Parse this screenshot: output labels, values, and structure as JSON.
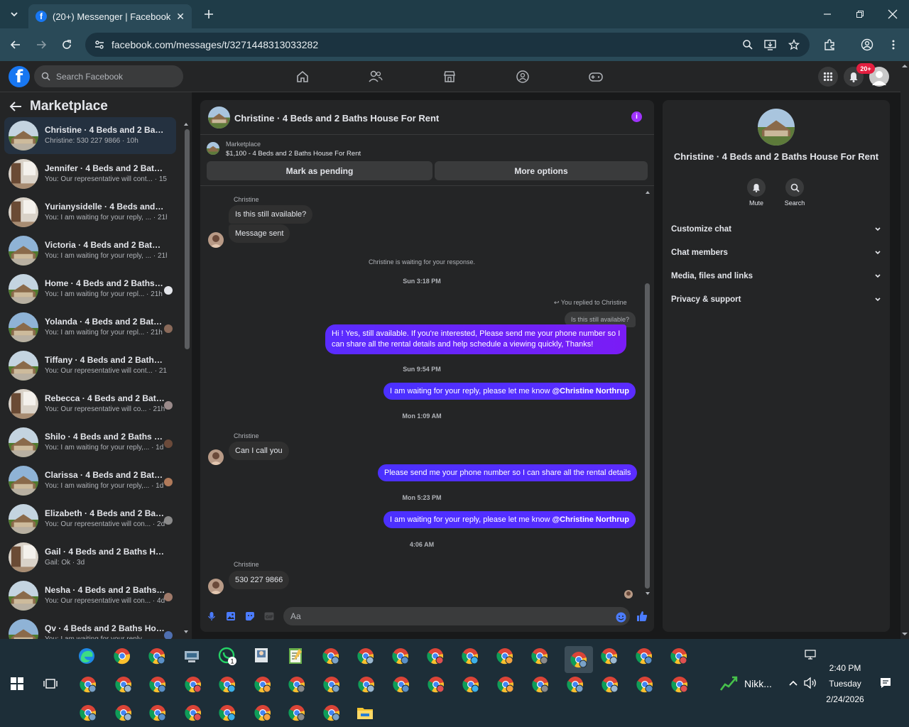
{
  "browser": {
    "tab_title": "(20+) Messenger | Facebook",
    "url": "facebook.com/messages/t/3271448313033282"
  },
  "fb_header": {
    "search_placeholder": "Search Facebook",
    "notification_badge": "20+"
  },
  "left_panel": {
    "title": "Marketplace",
    "conversations": [
      {
        "name": "Christine · 4 Beds and 2 Baths ...",
        "snippet": "Christine: 530 227 9866 · 10h",
        "active": true
      },
      {
        "name": "Jennifer · 4 Beds and 2 Baths H...",
        "snippet": "You: Our representative will cont... · 15h"
      },
      {
        "name": "Yurianysidelle · 4 Beds and 2 Ba...",
        "snippet": "You: I am waiting for your reply, ... · 21h"
      },
      {
        "name": "Victoria · 4 Beds and 2 Baths H...",
        "snippet": "You: I am waiting for your reply, ... · 21h"
      },
      {
        "name": "Home · 4 Beds and 2 Baths H...",
        "snippet": "You: I am waiting for your repl... · 21h"
      },
      {
        "name": "Yolanda · 4 Beds and 2 Baths ...",
        "snippet": "You: I am waiting for your repl... · 21h"
      },
      {
        "name": "Tiffany · 4 Beds and 2 Baths Ho...",
        "snippet": "You: Our representative will cont... · 21h"
      },
      {
        "name": "Rebecca · 4 Beds and 2 Baths...",
        "snippet": "You: Our representative will co... · 21h"
      },
      {
        "name": "Shilo · 4 Beds and 2 Baths Ho...",
        "snippet": "You: I am waiting for your reply,... · 1d"
      },
      {
        "name": "Clarissa · 4 Beds and 2 Baths ...",
        "snippet": "You: I am waiting for your reply,... · 1d"
      },
      {
        "name": "Elizabeth · 4 Beds and 2 Bath...",
        "snippet": "You: Our representative will con... · 2d"
      },
      {
        "name": "Gail · 4 Beds and 2 Baths House...",
        "snippet": "Gail: Ok · 3d"
      },
      {
        "name": "Nesha · 4 Beds and 2 Baths H...",
        "snippet": "You: Our representative will con... · 4d"
      },
      {
        "name": "Qv · 4 Beds and 2 Baths Hous...",
        "snippet": "You: I am waiting for your reply..."
      }
    ]
  },
  "chat": {
    "title": "Christine · 4 Beds and 2 Baths House For Rent",
    "marketplace_label": "Marketplace",
    "listing": "$1,100 - 4 Beds and 2 Baths House For Rent",
    "mark_pending": "Mark as pending",
    "more_options": "More options",
    "sender1": "Christine",
    "msg1": "Is this still available?",
    "msg2": "Message sent",
    "waiting": "Christine is waiting for your response.",
    "ts1": "Sun 3:18 PM",
    "replied": "You replied to Christine",
    "quoted": "Is this still available?",
    "out1_line1": "Hi ! Yes, still available. If you're interested, Please send me your phone number so I",
    "out1_line2": "can share all the rental details and help schedule a viewing quickly, Thanks!",
    "ts2": "Sun 9:54 PM",
    "out2_text": "I am waiting for your reply, please let me know ",
    "mention": "@Christine Northrup",
    "ts3": "Mon 1:09 AM",
    "sender2": "Christine",
    "msg3": "Can I call you",
    "out3": "Please send me your phone number so I can share all the rental details",
    "ts4": "Mon 5:23 PM",
    "ts5": "4:06 AM",
    "sender3": "Christine",
    "msg4": "530 227 9866",
    "composer_placeholder": "Aa"
  },
  "right_panel": {
    "title": "Christine · 4 Beds and 2 Baths House For Rent",
    "mute": "Mute",
    "search": "Search",
    "sections": [
      "Customize chat",
      "Chat members",
      "Media, files and links",
      "Privacy & support"
    ]
  },
  "taskbar": {
    "time": "2:40 PM",
    "day": "Tuesday",
    "date": "2/24/2026",
    "tray_label": "Nikk...",
    "whatsapp_badge": "1"
  },
  "colors": {
    "fb_blue": "#1877f2",
    "messenger_purple": "#6d26ff",
    "badge_red": "#e41e3f"
  }
}
